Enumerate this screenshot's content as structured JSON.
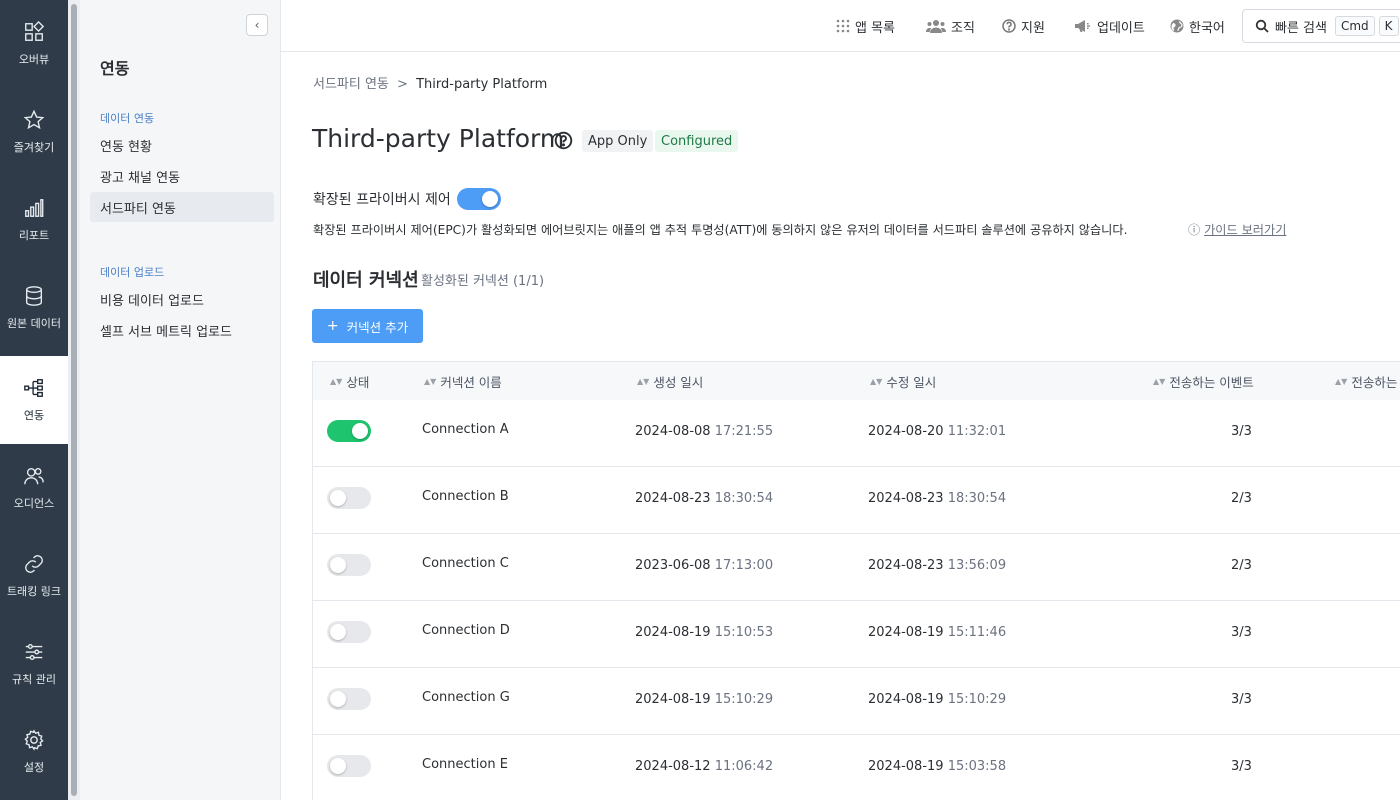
{
  "rail": {
    "items": [
      {
        "label": "오버뷰",
        "icon": "overview-icon"
      },
      {
        "label": "즐겨찾기",
        "icon": "star-icon"
      },
      {
        "label": "리포트",
        "icon": "bar-chart-icon"
      },
      {
        "label": "원본 데이터",
        "icon": "database-icon"
      },
      {
        "label": "연동",
        "icon": "integration-icon"
      },
      {
        "label": "오디언스",
        "icon": "audience-icon"
      },
      {
        "label": "트래킹 링크",
        "icon": "link-icon"
      },
      {
        "label": "규칙 관리",
        "icon": "sliders-icon"
      },
      {
        "label": "설정",
        "icon": "gear-icon"
      }
    ]
  },
  "sidebar": {
    "title": "연동",
    "groups": [
      {
        "label": "데이터 연동",
        "items": [
          "연동 현황",
          "광고 채널 연동",
          "서드파티 연동"
        ]
      },
      {
        "label": "데이터 업로드",
        "items": [
          "비용 데이터 업로드",
          "셀프 서브 메트릭 업로드"
        ]
      }
    ]
  },
  "topbar": {
    "apps": "앱 목록",
    "org": "조직",
    "support": "지원",
    "updates": "업데이트",
    "language": "한국어",
    "search_label": "빠른 검색",
    "shortcut_cmd": "Cmd",
    "shortcut_k": "K"
  },
  "breadcrumb": {
    "parent": "서드파티 연동",
    "separator": ">",
    "current": "Third-party Platform"
  },
  "page": {
    "title": "Third-party Platform",
    "badge_app_only": "App Only",
    "badge_configured": "Configured"
  },
  "epc": {
    "title": "확장된 프라이버시 제어",
    "enabled": true,
    "description": "확장된 프라이버시 제어(EPC)가 활성화되면 에어브릿지는 애플의 앱 추적 투명성(ATT)에 동의하지 않은 유저의 데이터를 서드파티 솔루션에 공유하지 않습니다.",
    "guide_link": "가이드 보러가기"
  },
  "connections": {
    "title": "데이터 커넥션",
    "subtitle": "활성화된 커넥션 (1/1)",
    "add_button": "커넥션 추가",
    "columns": [
      "상태",
      "커넥션 이름",
      "생성 일시",
      "수정 일시",
      "전송하는 이벤트",
      "전송하는"
    ],
    "rows": [
      {
        "enabled": true,
        "name": "Connection A",
        "created_date": "2024-08-08",
        "created_time": "17:21:55",
        "modified_date": "2024-08-20",
        "modified_time": "11:32:01",
        "events": "3/3"
      },
      {
        "enabled": false,
        "name": "Connection B",
        "created_date": "2024-08-23",
        "created_time": "18:30:54",
        "modified_date": "2024-08-23",
        "modified_time": "18:30:54",
        "events": "2/3"
      },
      {
        "enabled": false,
        "name": "Connection C",
        "created_date": "2023-06-08",
        "created_time": "17:13:00",
        "modified_date": "2024-08-23",
        "modified_time": "13:56:09",
        "events": "2/3"
      },
      {
        "enabled": false,
        "name": "Connection D",
        "created_date": "2024-08-19",
        "created_time": "15:10:53",
        "modified_date": "2024-08-19",
        "modified_time": "15:11:46",
        "events": "3/3"
      },
      {
        "enabled": false,
        "name": "Connection G",
        "created_date": "2024-08-19",
        "created_time": "15:10:29",
        "modified_date": "2024-08-19",
        "modified_time": "15:10:29",
        "events": "3/3"
      },
      {
        "enabled": false,
        "name": "Connection E",
        "created_date": "2024-08-12",
        "created_time": "11:06:42",
        "modified_date": "2024-08-19",
        "modified_time": "15:03:58",
        "events": "3/3"
      }
    ]
  },
  "colors": {
    "rail_bg": "#2f3b48",
    "primary": "#4d9cf5",
    "toggle_on": "#1ec46e",
    "configured_text": "#1f7a45"
  }
}
